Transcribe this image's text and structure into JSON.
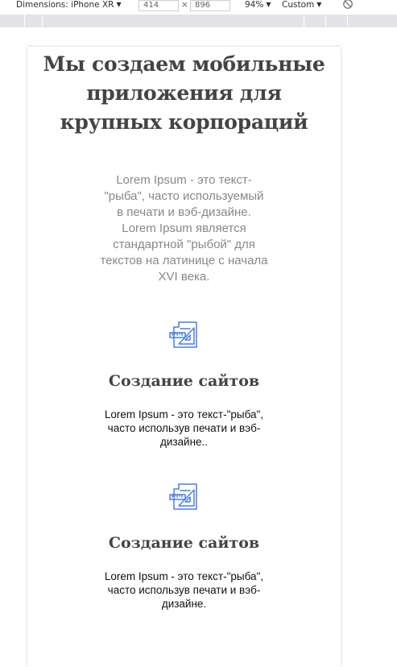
{
  "devtools": {
    "dimensions_label": "Dimensions: iPhone XR",
    "width_value": "414",
    "times_sign": "×",
    "height_value": "896",
    "zoom": "94%",
    "throttle": "Custom",
    "arrow": "▼",
    "rotate_icon": "rotate-icon"
  },
  "hero": {
    "title": "Мы создаем мобильные приложения для крупных корпораций",
    "text": "Lorem Ipsum - это текст-\"рыба\", часто используемый в печати и вэб-дизайне. Lorem Ipsum является стандартной \"рыбой\" для текстов на латинице с начала XVI века."
  },
  "services": [
    {
      "icon": "drafting-tools-icon",
      "title": "Создание сайтов",
      "text": "Lorem Ipsum - это текст-\"рыба\", часто использув печати и вэб-дизайне.."
    },
    {
      "icon": "drafting-tools-icon",
      "title": "Создание сайтов",
      "text": "Lorem Ipsum - это текст-\"рыба\", часто использув печати и вэб-дизайне."
    }
  ],
  "colors": {
    "heading": "#444444",
    "hero_text": "#888888",
    "icon_blue": "#4a7fe0",
    "ruler": "#e3e4e8"
  }
}
